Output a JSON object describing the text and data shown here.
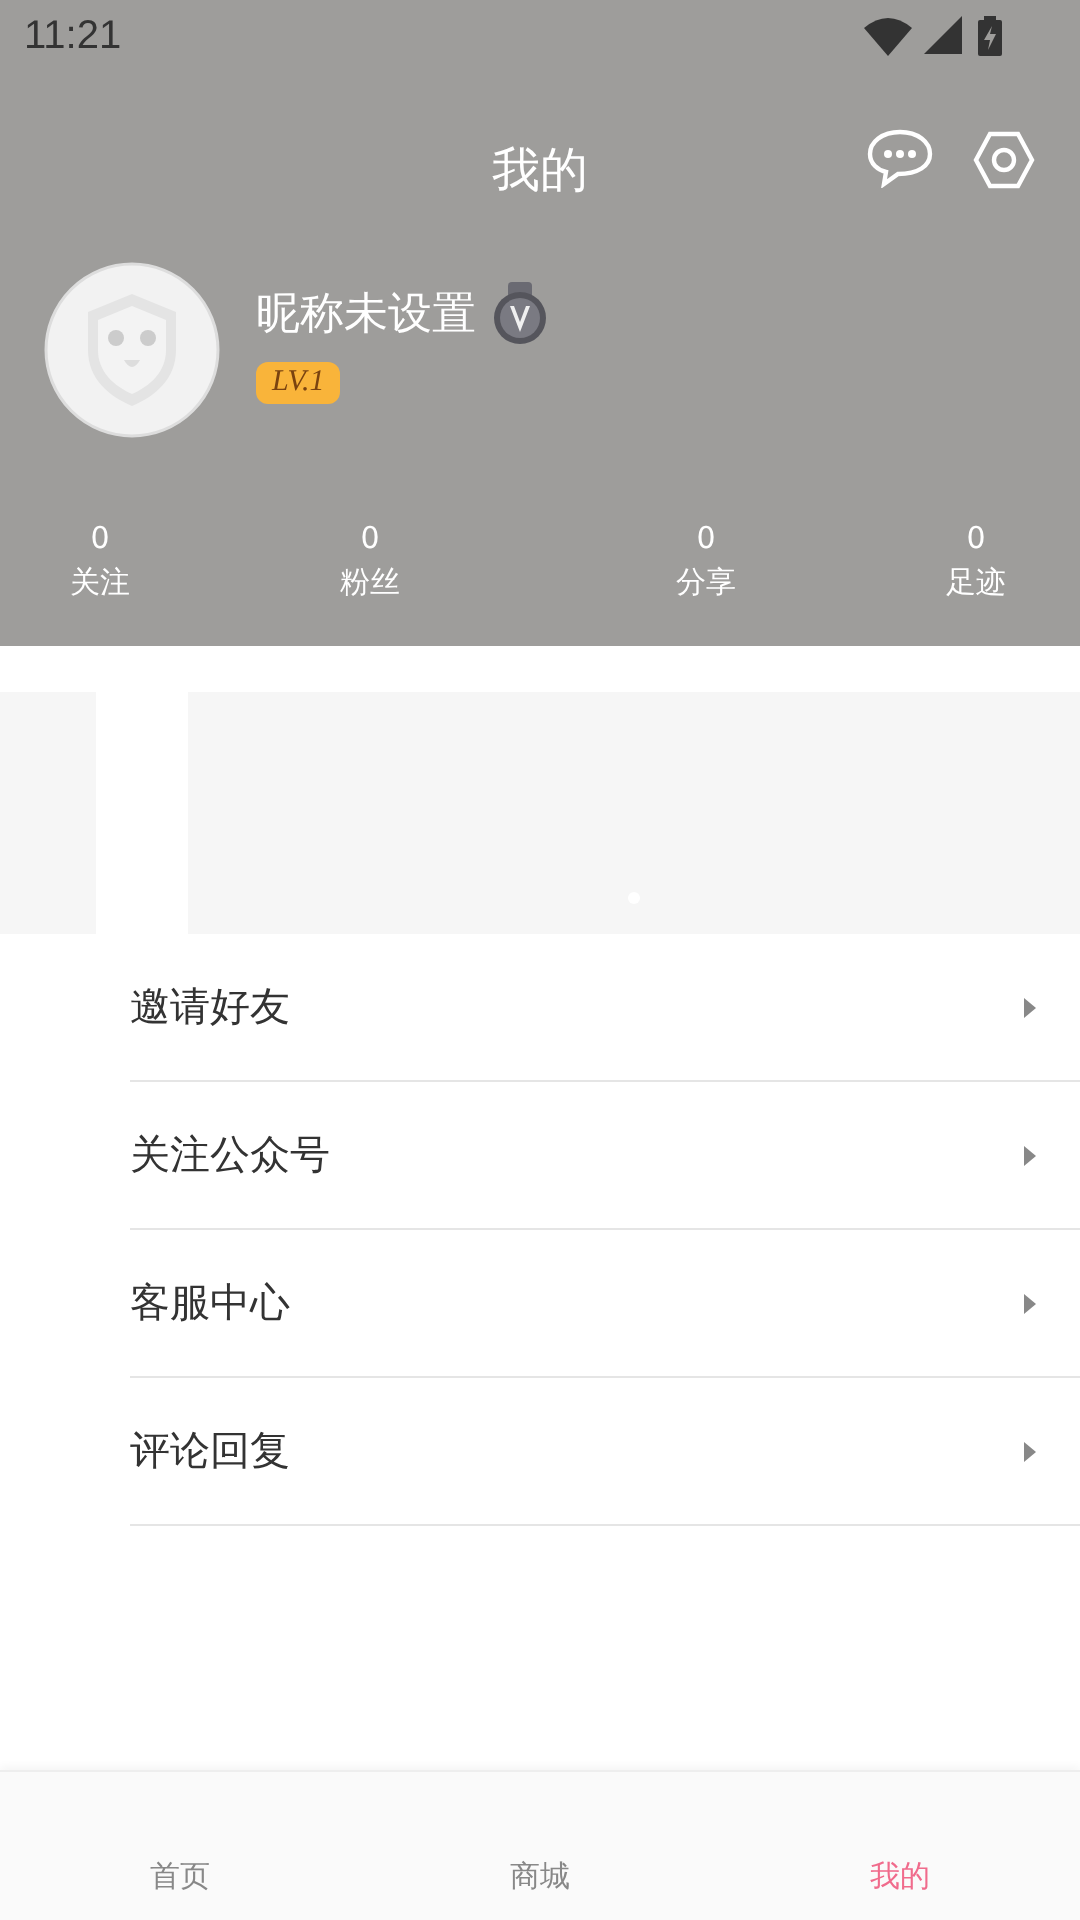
{
  "status_bar": {
    "time": "11:21"
  },
  "header": {
    "title": "我的"
  },
  "profile": {
    "nickname": "昵称未设置",
    "level_badge": "LV.1"
  },
  "stats": [
    {
      "value": "0",
      "label": "关注"
    },
    {
      "value": "0",
      "label": "粉丝"
    },
    {
      "value": "0",
      "label": "分享"
    },
    {
      "value": "0",
      "label": "足迹"
    }
  ],
  "banner": {
    "indicators": [
      {
        "selected": true
      }
    ]
  },
  "menu": [
    {
      "label": "邀请好友"
    },
    {
      "label": "关注公众号"
    },
    {
      "label": "客服中心"
    },
    {
      "label": "评论回复"
    }
  ],
  "tabs": [
    {
      "label": "首页",
      "selected": false
    },
    {
      "label": "商城",
      "selected": false
    },
    {
      "label": "我的",
      "selected": true
    }
  ]
}
